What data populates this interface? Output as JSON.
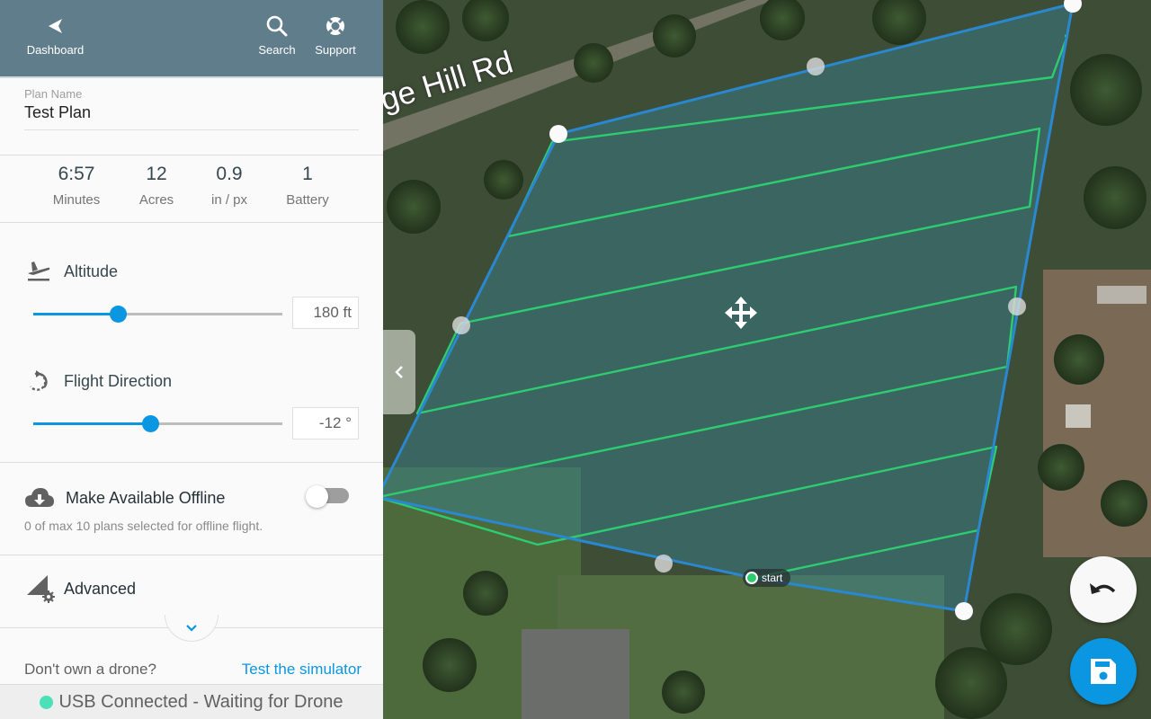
{
  "header": {
    "back_label": "Dashboard",
    "search_label": "Search",
    "support_label": "Support"
  },
  "plan": {
    "name_label": "Plan Name",
    "name_value": "Test Plan"
  },
  "stats": [
    {
      "value": "6:57",
      "unit": "Minutes"
    },
    {
      "value": "12",
      "unit": "Acres"
    },
    {
      "value": "0.9",
      "unit": "in / px"
    },
    {
      "value": "1",
      "unit": "Battery"
    }
  ],
  "altitude": {
    "label": "Altitude",
    "value_text": "180 ft",
    "slider_fraction": 0.34
  },
  "flight_direction": {
    "label": "Flight Direction",
    "value_text": "-12 °",
    "slider_fraction": 0.47
  },
  "offline": {
    "label": "Make Available Offline",
    "subtext": "0 of max 10 plans selected for offline flight.",
    "enabled": false
  },
  "advanced": {
    "label": "Advanced"
  },
  "promo": {
    "question": "Don't own a drone?",
    "link": "Test the simulator"
  },
  "status": {
    "text": "USB Connected - Waiting for Drone",
    "color": "#4be0b8"
  },
  "map": {
    "road_label": "ge Hill Rd",
    "start_label": "start",
    "boundary_color": "#2a88d0",
    "path_color": "#2ecc71",
    "accent_color": "#0a96e0"
  },
  "icons": {
    "back": "chevron-left-icon",
    "search": "search-icon",
    "support": "lifebuoy-icon",
    "altitude": "takeoff-icon",
    "direction": "rotate-icon",
    "offline": "cloud-download-icon",
    "advanced": "advanced-settings-icon",
    "expand": "chevron-down-icon",
    "collapse": "chevron-left-icon",
    "move": "move-icon",
    "undo": "undo-icon",
    "save": "save-icon"
  }
}
